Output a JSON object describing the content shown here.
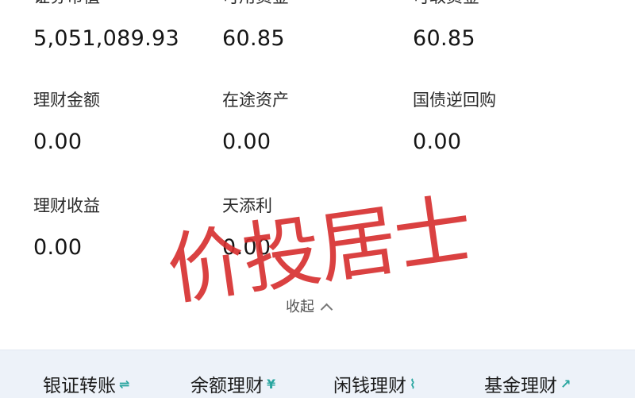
{
  "metrics": [
    {
      "label": "证券市值",
      "value": "5,051,089.93"
    },
    {
      "label": "可用资金",
      "value": "60.85"
    },
    {
      "label": "可取资金",
      "value": "60.85"
    },
    {
      "label": "理财金额",
      "value": "0.00"
    },
    {
      "label": "在途资产",
      "value": "0.00"
    },
    {
      "label": "国债逆回购",
      "value": "0.00"
    },
    {
      "label": "理财收益",
      "value": "0.00"
    },
    {
      "label": "天添利",
      "value": "0.00"
    }
  ],
  "collapse": {
    "label": "收起",
    "icon": "chevron-up-icon"
  },
  "watermark": {
    "text": "价投居士",
    "color": "#d62c2c"
  },
  "actions": [
    {
      "label": "银证转账",
      "icon": "transfer-icon",
      "glyph": "⇌"
    },
    {
      "label": "余额理财",
      "icon": "yen-icon",
      "glyph": "¥"
    },
    {
      "label": "闲钱理财",
      "icon": "chart-icon",
      "glyph": "⌇"
    },
    {
      "label": "基金理财",
      "icon": "trend-icon",
      "glyph": "↗"
    }
  ],
  "colors": {
    "action_bar_bg": "#edf2f9",
    "action_icon": "#2aa6a0"
  }
}
